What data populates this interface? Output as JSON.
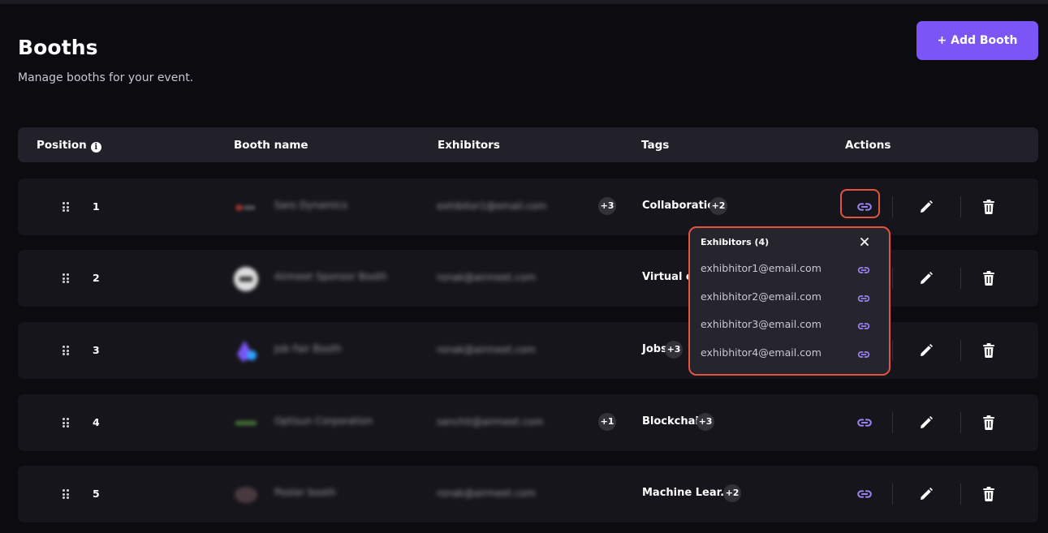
{
  "header": {
    "title": "Booths",
    "subtitle": "Manage booths for your event.",
    "add_button": "+ Add Booth"
  },
  "table": {
    "columns": [
      "Position",
      "Booth name",
      "Exhibitors",
      "Tags",
      "Actions"
    ],
    "rows": [
      {
        "position": "1",
        "booth_name": "Saro Dynamics",
        "exhibitor": "exhibitor1@email.com",
        "exhibitor_extra": "+3",
        "tag": "Collaboration",
        "tag_extra": "+2"
      },
      {
        "position": "2",
        "booth_name": "Airmeet Sponsor Booth",
        "exhibitor": "ronak@airmeet.com",
        "exhibitor_extra": "",
        "tag": "Virtual ev",
        "tag_extra": ""
      },
      {
        "position": "3",
        "booth_name": "Job Fair Booth",
        "exhibitor": "ronak@airmeet.com",
        "exhibitor_extra": "",
        "tag": "Jobs",
        "tag_extra": "+3"
      },
      {
        "position": "4",
        "booth_name": "Optisun Corporation",
        "exhibitor": "sanchit@airmeet.com",
        "exhibitor_extra": "+1",
        "tag": "Blockchain",
        "tag_extra": "+3"
      },
      {
        "position": "5",
        "booth_name": "Poster booth",
        "exhibitor": "ronak@airmeet.com",
        "exhibitor_extra": "",
        "tag": "Machine Lear...",
        "tag_extra": "+2"
      }
    ]
  },
  "popover": {
    "title": "Exhibitors (4)",
    "items": [
      "exhibhitor1@email.com",
      "exhibhitor2@email.com",
      "exhibhitor3@email.com",
      "exhibhitor4@email.com"
    ]
  },
  "icons": {
    "drag": "drag-handle-icon",
    "link": "link-icon",
    "edit": "pencil-icon",
    "delete": "trash-icon",
    "info": "info-icon",
    "close": "close-icon"
  },
  "colors": {
    "background": "#0c0b0f",
    "row": "#16151b",
    "header": "#222129",
    "accent": "#7b55f5",
    "link_icon": "#9b82f5",
    "highlight": "#e3533f"
  }
}
